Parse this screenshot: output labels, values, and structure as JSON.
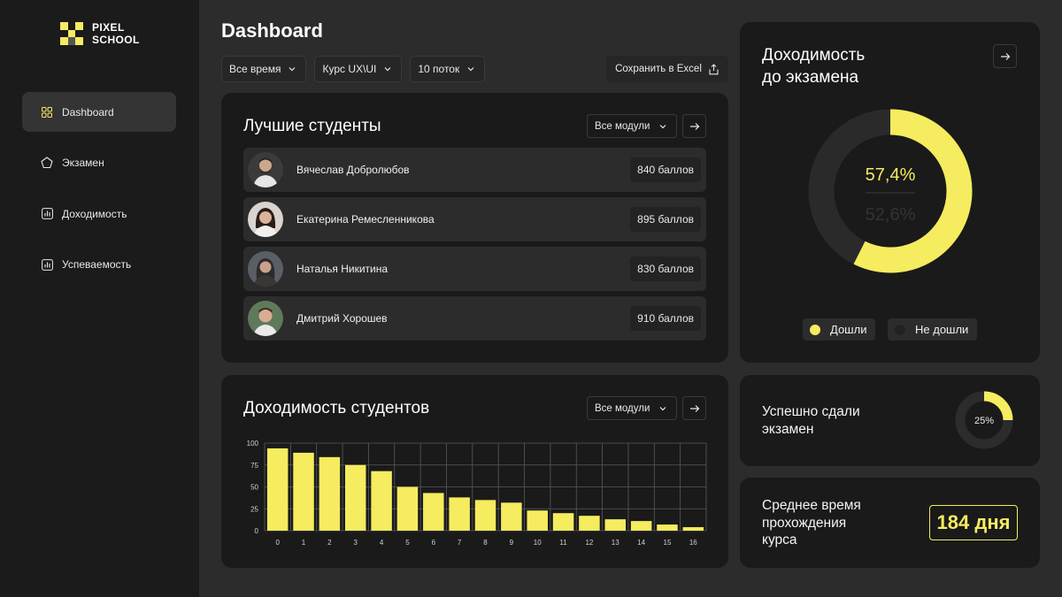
{
  "brand": {
    "line1": "PIXEL",
    "line2": "SCHOOL"
  },
  "sidebar": {
    "items": [
      {
        "label": "Dashboard",
        "icon": "grid-icon",
        "active": true
      },
      {
        "label": "Экзамен",
        "icon": "pentagon-icon",
        "active": false
      },
      {
        "label": "Доходимость",
        "icon": "bar-chart-icon",
        "active": false
      },
      {
        "label": "Успеваемость",
        "icon": "bar-chart-icon",
        "active": false
      }
    ]
  },
  "header": {
    "title": "Dashboard",
    "filters": [
      "Все время",
      "Курс UX\\UI",
      "10 поток"
    ],
    "save_label": "Сохранить в Excel"
  },
  "best_students": {
    "title": "Лучшие студенты",
    "module_filter": "Все модули",
    "rows": [
      {
        "name": "Вячеслав Добролюбов",
        "score": "840 баллов"
      },
      {
        "name": "Екатерина Ремесленникова",
        "score": "895 баллов"
      },
      {
        "name": "Наталья Никитина",
        "score": "830 баллов"
      },
      {
        "name": "Дмитрий Хорошев",
        "score": "910 баллов"
      }
    ]
  },
  "retention": {
    "title_line1": "Доходимость",
    "title_line2": "до экзамена",
    "primary_value": "57,4%",
    "secondary_value": "52,6%",
    "share": 0.574,
    "legend": [
      {
        "label": "Дошли",
        "color": "#f5ec5f"
      },
      {
        "label": "Не дошли",
        "color": "#2a2a2a"
      }
    ]
  },
  "students_chart": {
    "title": "Доходимость студентов",
    "module_filter": "Все модули"
  },
  "chart_data": {
    "type": "bar",
    "categories": [
      "0",
      "1",
      "2",
      "3",
      "4",
      "5",
      "6",
      "7",
      "8",
      "9",
      "10",
      "11",
      "12",
      "13",
      "14",
      "15",
      "16"
    ],
    "values": [
      94,
      89,
      84,
      75,
      68,
      50,
      43,
      38,
      35,
      32,
      23,
      20,
      17,
      13,
      11,
      7,
      4
    ],
    "ylim": [
      0,
      100
    ],
    "yticks": [
      "0",
      "25",
      "50",
      "75",
      "100"
    ],
    "grid": true,
    "bar_color": "#f5ec5f"
  },
  "passed_exam": {
    "title_line1": "Успешно сдали",
    "title_line2": "экзамен",
    "percent_label": "25%",
    "share": 0.25
  },
  "avg_time": {
    "title_line1": "Среднее время",
    "title_line2": "прохождения",
    "title_line3": "курса",
    "value": "184 дня"
  },
  "colors": {
    "accent": "#f5ec5f",
    "card": "#1a1a1a",
    "background": "#2c2c2c",
    "sidebar": "#1b1b1b"
  }
}
